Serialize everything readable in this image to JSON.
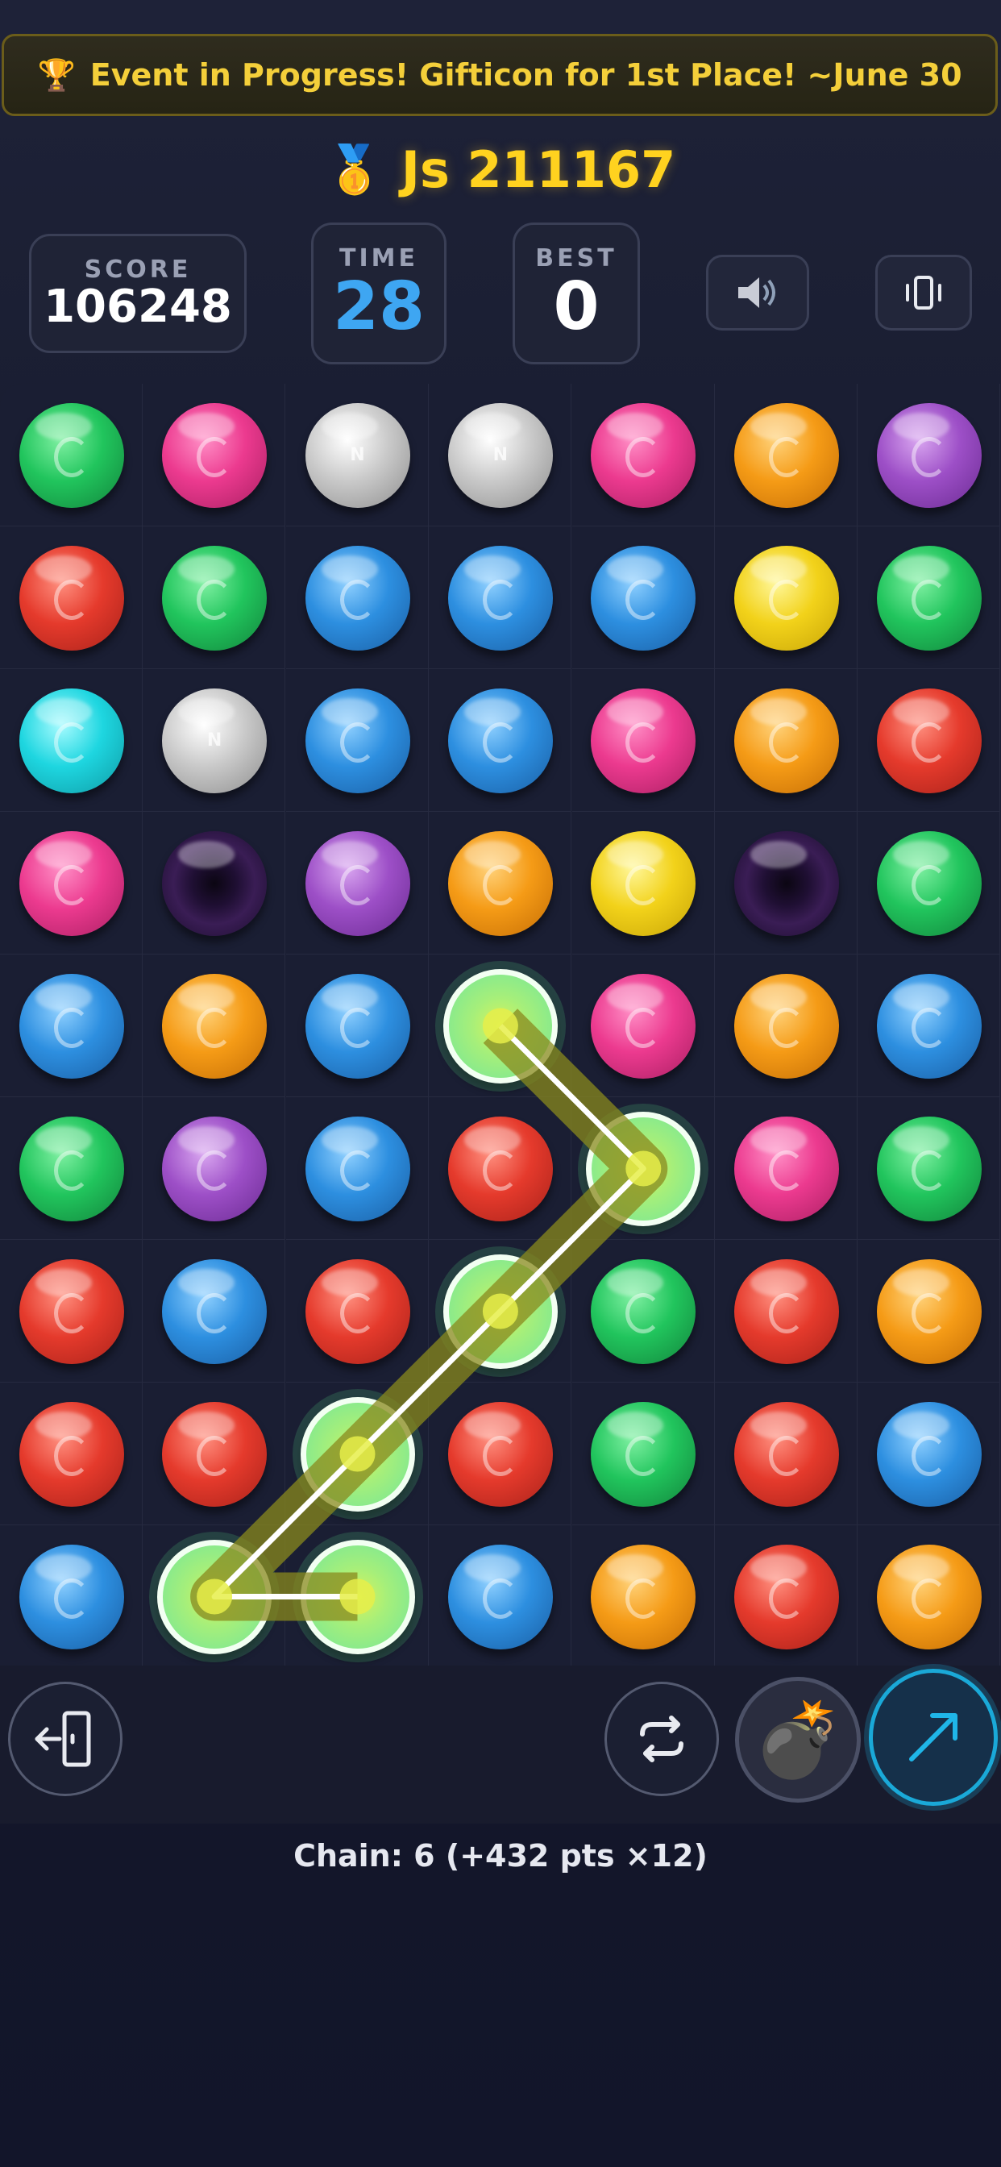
{
  "banner": {
    "icon": "trophy-icon",
    "text": "Event in Progress! Gifticon for 1st Place! ~June 30"
  },
  "player": {
    "icon": "medal-icon",
    "name_score": "Js 211167"
  },
  "stats": {
    "score_label": "SCORE",
    "score_value": "106248",
    "time_label": "TIME",
    "time_value": "28",
    "best_label": "BEST",
    "best_value": "0"
  },
  "buttons": {
    "sound": "speaker-icon",
    "vibrate": "vibrate-icon",
    "exit": "exit-icon",
    "shuffle": "shuffle-icon",
    "bomb": "bomb-icon",
    "hint": "arrow-icon"
  },
  "board": {
    "rows": 9,
    "cols": 7,
    "grid": [
      [
        "green",
        "pink",
        "silver",
        "silver",
        "pink",
        "orange",
        "purple"
      ],
      [
        "red",
        "green",
        "blue",
        "blue",
        "blue",
        "yellow",
        "green"
      ],
      [
        "cyan",
        "silver",
        "blue",
        "blue",
        "pink",
        "orange",
        "red"
      ],
      [
        "pink",
        "vortex",
        "purple",
        "orange",
        "yellow",
        "vortex",
        "green"
      ],
      [
        "blue",
        "orange",
        "blue",
        "selected",
        "pink",
        "orange",
        "blue"
      ],
      [
        "green",
        "purple",
        "blue",
        "red",
        "selected",
        "pink",
        "green"
      ],
      [
        "red",
        "blue",
        "red",
        "selected",
        "green",
        "red",
        "orange"
      ],
      [
        "red",
        "red",
        "selected",
        "red",
        "green",
        "red",
        "blue"
      ],
      [
        "blue",
        "selected",
        "selected",
        "blue",
        "orange",
        "red",
        "orange"
      ]
    ],
    "chain_path": [
      [
        4,
        3
      ],
      [
        5,
        4
      ],
      [
        6,
        3
      ],
      [
        7,
        2
      ],
      [
        8,
        1
      ],
      [
        8,
        2
      ]
    ],
    "colors": {
      "selected_glow": "#a6ef7a",
      "path_line": "#ffffff",
      "path_band": "#8a8a1e"
    }
  },
  "status": {
    "chain_text": "Chain: 6 (+432 pts ×12)"
  }
}
